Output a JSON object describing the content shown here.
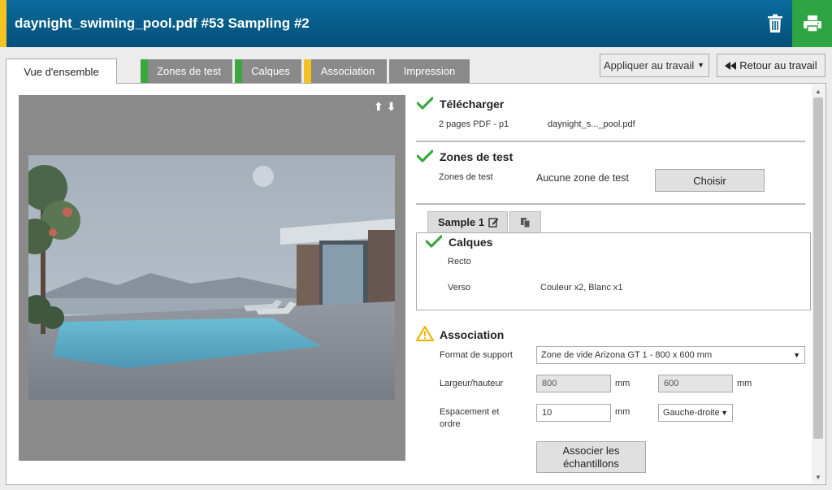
{
  "header": {
    "title": "daynight_swiming_pool.pdf #53 Sampling #2"
  },
  "tabs": [
    {
      "label": "Vue d'ensemble",
      "active": true,
      "flag": ""
    },
    {
      "label": "Zones de test",
      "active": false,
      "flag": "#3aa83f"
    },
    {
      "label": "Calques",
      "active": false,
      "flag": "#3aa83f"
    },
    {
      "label": "Association",
      "active": false,
      "flag": "#f3c322"
    },
    {
      "label": "Impression",
      "active": false,
      "flag": ""
    }
  ],
  "toolbar": {
    "apply_label": "Appliquer au travail",
    "back_label": "Retour au travail"
  },
  "download": {
    "title": "Télécharger",
    "pages": "2 pages PDF - p1",
    "filename": "daynight_s..._pool.pdf"
  },
  "testzones": {
    "title": "Zones de test",
    "label": "Zones de test",
    "value": "Aucune zone de test",
    "choose_label": "Choisir"
  },
  "sample": {
    "tab_label": "Sample 1",
    "layers_title": "Calques",
    "recto_label": "Recto",
    "recto_value": "",
    "verso_label": "Verso",
    "verso_value": "Couleur x2, Blanc x1"
  },
  "association": {
    "title": "Association",
    "format_label": "Format de support",
    "format_value": "Zone de vide Arizona GT 1 - 800 x 600 mm",
    "size_label": "Largeur/hauteur",
    "width_value": "800",
    "height_value": "600",
    "unit": "mm",
    "spacing_label_1": "Espacement et",
    "spacing_label_2": "ordre",
    "spacing_value": "10",
    "order_value": "Gauche-droite",
    "associate_label_1": "Associer les",
    "associate_label_2": "échantillons"
  },
  "colors": {
    "header": "#0a6b9c",
    "accent_yellow": "#f3c322",
    "accent_green": "#2ea443",
    "check_green": "#3aa83f",
    "warning": "#f0b400"
  }
}
